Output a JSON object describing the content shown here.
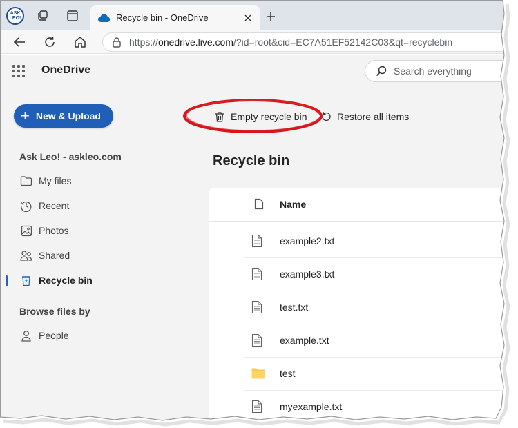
{
  "browser": {
    "profile_label_1": "ASK",
    "profile_label_2": "LEO!",
    "tab_title": "Recycle bin - OneDrive",
    "tab_close": "✕",
    "new_tab": "+",
    "url_scheme": "https://",
    "url_host": "onedrive.live.com",
    "url_path": "/?id=root&cid=EC7A51EF52142C03&qt=recyclebin"
  },
  "app": {
    "brand": "OneDrive",
    "search_placeholder": "Search everything",
    "new_upload_label": "New & Upload",
    "account_label": "Ask Leo! - askleo.com",
    "browse_label": "Browse files by",
    "accent_color": "#1f5fb8"
  },
  "sidebar": {
    "items": [
      {
        "label": "My files",
        "icon": "folder-icon"
      },
      {
        "label": "Recent",
        "icon": "clock-icon"
      },
      {
        "label": "Photos",
        "icon": "image-icon"
      },
      {
        "label": "Shared",
        "icon": "people-icon"
      },
      {
        "label": "Recycle bin",
        "icon": "recycle-bin-icon",
        "active": true
      }
    ],
    "browse_items": [
      {
        "label": "People",
        "icon": "person-icon"
      }
    ]
  },
  "commands": {
    "empty_label": "Empty recycle bin",
    "restore_label": "Restore all items",
    "highlight_color": "#d9141c"
  },
  "main": {
    "title": "Recycle bin",
    "column_name": "Name",
    "files": [
      {
        "name": "example2.txt",
        "type": "file"
      },
      {
        "name": "example3.txt",
        "type": "file"
      },
      {
        "name": "test.txt",
        "type": "file"
      },
      {
        "name": "example.txt",
        "type": "file"
      },
      {
        "name": "test",
        "type": "folder"
      },
      {
        "name": "myexample.txt",
        "type": "file"
      }
    ]
  }
}
